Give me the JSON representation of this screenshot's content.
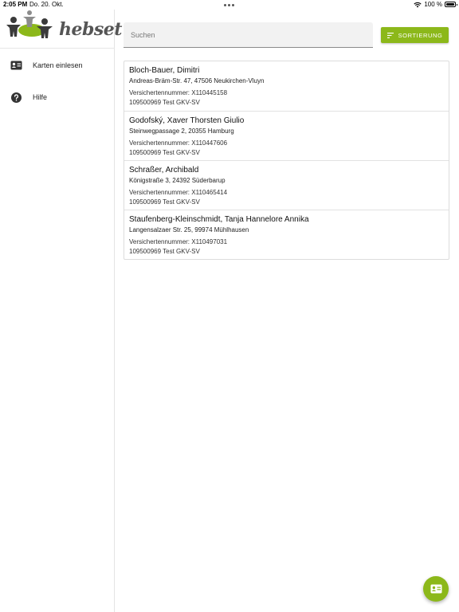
{
  "status_bar": {
    "time": "2:05 PM",
    "date": "Do. 20. Okt.",
    "battery": "100 %"
  },
  "sidebar": {
    "logo_text": "hebset",
    "items": [
      {
        "label": "Karten einlesen",
        "icon": "card-reader-icon"
      },
      {
        "label": "Hilfe",
        "icon": "help-icon"
      }
    ]
  },
  "search": {
    "placeholder": "Suchen",
    "value": ""
  },
  "sort_button": {
    "label": "SORTIERUNG",
    "icon": "sort-icon"
  },
  "patients": [
    {
      "name": "Bloch-Bauer, Dimitri",
      "address": "Andreas-Bräm-Str. 47, 47506 Neukirchen-Vluyn",
      "insurance_number": "Versichertennummer: X110445158",
      "insurer": "109500969 Test GKV-SV"
    },
    {
      "name": "Godofský, Xaver Thorsten Giulio",
      "address": "Steinwegpassage 2, 20355 Hamburg",
      "insurance_number": "Versichertennummer: X110447606",
      "insurer": "109500969 Test GKV-SV"
    },
    {
      "name": "Schraßer, Archibald",
      "address": "Königstraße 3, 24392 Süderbarup",
      "insurance_number": "Versichertennummer: X110465414",
      "insurer": "109500969 Test GKV-SV"
    },
    {
      "name": "Staufenberg-Kleinschmidt, Tanja Hannelore Annika",
      "address": "Langensalzaer Str. 25, 99974 Mühlhausen",
      "insurance_number": "Versichertennummer: X110497031",
      "insurer": "109500969 Test GKV-SV"
    }
  ],
  "fab": {
    "icon": "card-reader-icon"
  },
  "colors": {
    "accent": "#8cb81a",
    "logo_gray": "#555555"
  }
}
